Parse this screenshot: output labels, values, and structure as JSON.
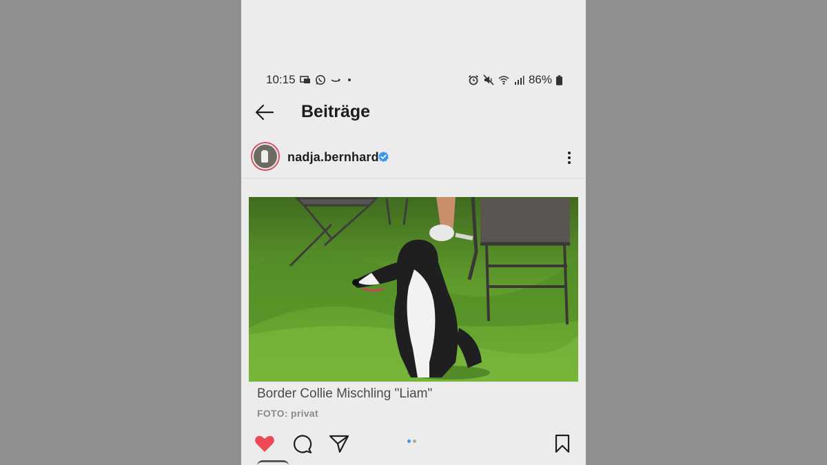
{
  "status_bar": {
    "time": "10:15",
    "battery": "86%",
    "left_icons": [
      "message-icon",
      "whatsapp-icon",
      "amazon-icon",
      "dot-icon"
    ],
    "right_icons": [
      "alarm-icon",
      "mute-icon",
      "wifi-icon",
      "signal-icon",
      "battery-icon"
    ]
  },
  "header": {
    "title": "Beiträge",
    "back_icon": "arrow-left-icon"
  },
  "post": {
    "username": "nadja.bernhard",
    "verified": true,
    "image_caption": "Border Collie Mischling \"Liam\"",
    "image_credit": "FOTO: privat",
    "liked": true,
    "carousel": {
      "count": 2,
      "active": 1
    }
  },
  "colors": {
    "background": "#8f8f8f",
    "screen": "#ececec",
    "like": "#ed4956",
    "verified": "#3897f0",
    "pager_active": "#3897f0",
    "pager_inactive": "#a8a8a8"
  },
  "actions": [
    "heart-icon",
    "comment-icon",
    "share-icon",
    "bookmark-icon"
  ]
}
